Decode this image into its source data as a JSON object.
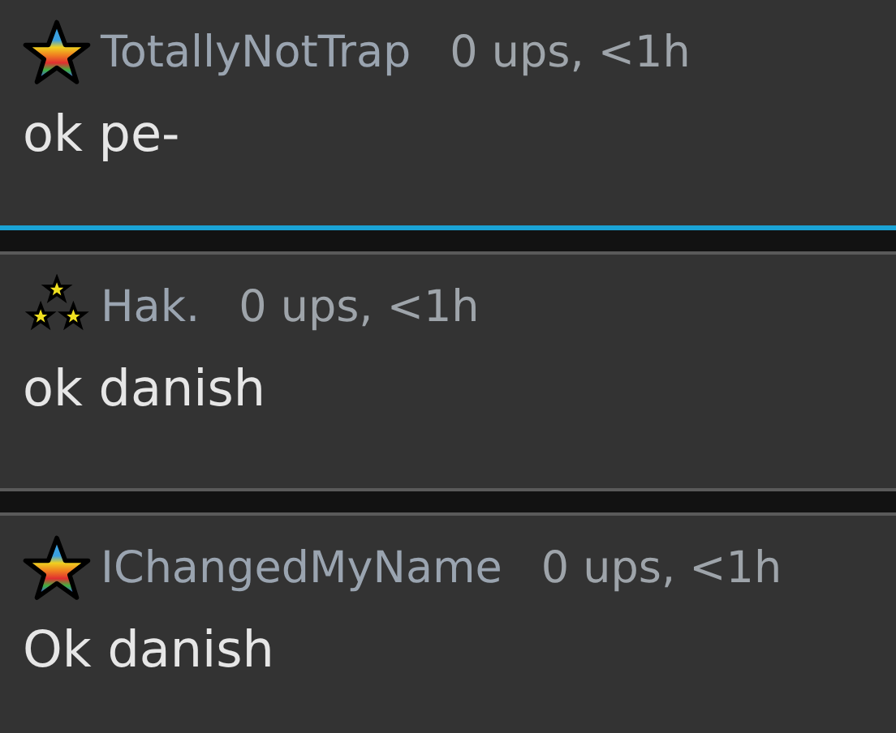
{
  "comments": [
    {
      "badge": {
        "kind": "rainbow-star"
      },
      "username": "TotallyNotTrap",
      "meta": "0 ups, <1h",
      "text": "ok pe-",
      "highlighted": true
    },
    {
      "badge": {
        "kind": "three-stars"
      },
      "username": "Hak.",
      "meta": "0 ups, <1h",
      "text": "ok danish",
      "highlighted": false
    },
    {
      "badge": {
        "kind": "rainbow-star"
      },
      "username": "IChangedMyName",
      "meta": "0 ups, <1h",
      "text": "Ok danish",
      "highlighted": false
    }
  ]
}
